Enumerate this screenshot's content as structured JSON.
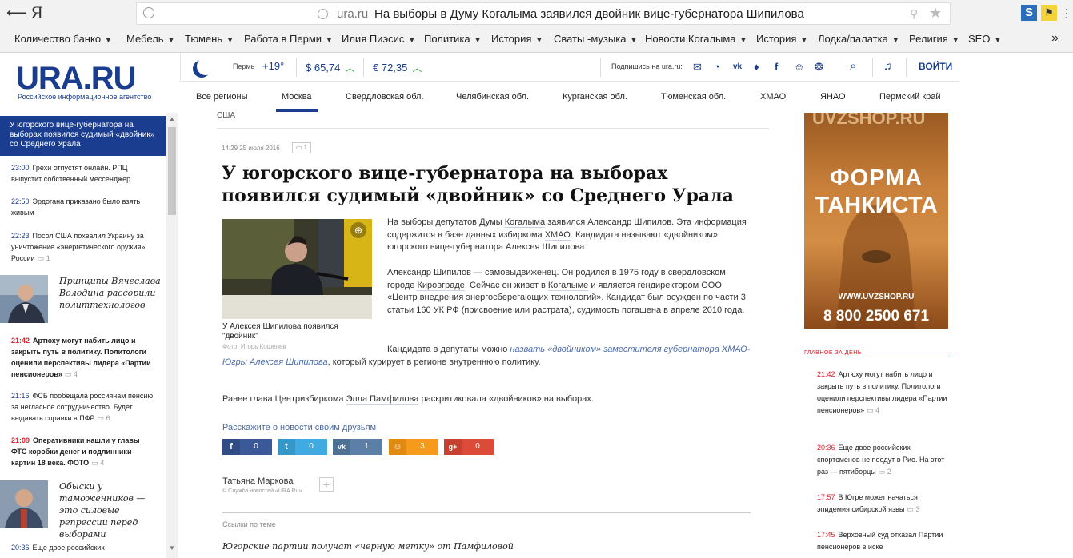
{
  "browser": {
    "logo": "Я",
    "domain": "ura.ru",
    "page_title": "На выборы в Думу Когалыма заявился двойник вице-губернатора Шипилова",
    "ext1": "S",
    "ext2": "⚑",
    "bookmarks": [
      "Количество банко",
      "Мебель",
      "Тюмень",
      "Работа в Перми",
      "Илия Пиэсис",
      "Политика",
      "История",
      "Сваты -музыка",
      "Новости Когалыма",
      "История",
      "Лодка/палатка",
      "Религия",
      "SEO"
    ],
    "more": "»"
  },
  "site": {
    "logo": "URA.RU",
    "logo_sub": "Российское информационное агентство",
    "weather_city": "Пермь",
    "weather_temp": "+19°",
    "usd": "$  65,74",
    "eur": "€  72,35",
    "subscribe": "Подпишись на ura.ru:",
    "login": "ВОЙТИ",
    "regions": [
      "Все регионы",
      "Москва",
      "Свердловская обл.",
      "Челябинская обл.",
      "Курганская обл.",
      "Тюменская обл.",
      "ХМАО",
      "ЯНАО",
      "Пермский край"
    ],
    "active_region": "Москва"
  },
  "sidebar": {
    "featured": "У югорского вице-губернатора на выборах появился судимый «двойник» со Среднего Урала",
    "items": [
      {
        "time": "23:00",
        "text": "Грехи отпустят онлайн. РПЦ выпустит собственный мессенджер",
        "comments": ""
      },
      {
        "time": "22:50",
        "text": "Эрдогана приказано было взять живым",
        "comments": ""
      },
      {
        "time": "22:23",
        "text": "Посол США похвалил Украину за уничтожение «энергетического оружия» России",
        "comments": "1"
      },
      {
        "time": "21:42",
        "text": "Артюху могут набить лицо и закрыть путь в политику. Политологи оценили перспективы лидера «Партии пенсионеров»",
        "comments": "4"
      },
      {
        "time": "21:16",
        "text": "ФСБ пообещала россиянам пенсию за негласное сотрудничество. Будет выдавать справки в ПФР",
        "comments": "6"
      },
      {
        "time": "21:09",
        "text": "Оперативники нашли у главы ФТС коробки денег и подлинники картин 18 века. ФОТО",
        "comments": "4"
      },
      {
        "time": "20:36",
        "text": "Еще двое российских",
        "comments": ""
      }
    ],
    "photo1": "Принципы Вячеслава Володина рассорили политтехнологов",
    "photo2": "Обыски у таможенников — это силовые репрессии перед выборами"
  },
  "article": {
    "breadcrumb": "США",
    "datetime": "14:29  25 июля 2016",
    "comments": "1",
    "headline": "У югорского вице-губернатора на выборах появился судимый «двойник» со Среднего Урала",
    "photo_caption": "У Алексея Шипилова появился \"двойник\"",
    "photo_credit": "Фото: Игорь Кошелев",
    "p1_a": "На выборы депутатов Думы ",
    "p1_link1": "Когалыма",
    "p1_b": " заявился Александр Шипилов. Эта информация содержится в базе данных избиркома ",
    "p1_link2": "ХМАО",
    "p1_c": ". Кандидата называют «двойником» югорского вице-губернатора Алексея Шипилова.",
    "p2_a": "Александр Шипилов — самовыдвиженец. Он родился в 1975 году в свердловском городе ",
    "p2_link1": "Кировграде",
    "p2_b": ". Сейчас он живет в ",
    "p2_link2": "Когалыме",
    "p2_c": " и является гендиректором ООО «Центр внедрения энергосберегающих технологий». Кандидат был осужден по части 3 статьи 160 УК РФ (присвоение или растрата), судимость погашена в апреле 2010 года.",
    "p3_a": "Кандидата в депутаты можно ",
    "p3_link": "назвать «двойником» заместителя губернатора ХМАО-Югры Алексея Шипилова",
    "p3_b": ", который курирует в регионе внутреннюю политику.",
    "p4_a": "Ранее глава Центризбиркома ",
    "p4_link": "Элла Памфилова",
    "p4_b": " раскритиковала «двойников» на выборах.",
    "share_title": "Расскажите о новости своим друзьям",
    "shares": [
      {
        "icon": "f",
        "count": "0",
        "color": "#3b5998"
      },
      {
        "icon": "t",
        "count": "0",
        "color": "#41abe1"
      },
      {
        "icon": "vk",
        "count": "1",
        "color": "#5b7fa6"
      },
      {
        "icon": "ok",
        "count": "3",
        "color": "#f59a1b"
      },
      {
        "icon": "g+",
        "count": "0",
        "color": "#dc4a38"
      }
    ],
    "author": "Татьяна Маркова",
    "author_src": "© Служба новостей «URA.Ru»",
    "links_title": "Ссылки по теме",
    "related": "Югорские партии получат «черную метку» от Памфиловой"
  },
  "ad": {
    "url_top": "UVZSHOP.RU",
    "line1": "ФОРМА",
    "line2": "ТАНКИСТА",
    "site": "WWW.UVZSHOP.RU",
    "phone": "8 800 2500 671"
  },
  "right": {
    "title": "ГЛАВНОЕ ЗА ДЕНЬ",
    "items": [
      {
        "time": "21:42",
        "text": "Артюху могут набить лицо и закрыть путь в политику. Политологи оценили перспективы лидера «Партии пенсионеров»",
        "comments": "4"
      },
      {
        "time": "20:36",
        "text": "Еще двое российских спортсменов не поедут в Рио. На этот раз — пятиборцы",
        "comments": "2"
      },
      {
        "time": "17:57",
        "text": "В Югре может начаться эпидемия сибирской язвы",
        "comments": "3"
      },
      {
        "time": "17:45",
        "text": "Верховный суд отказал Партии пенсионеров в иске",
        "comments": ""
      }
    ]
  }
}
